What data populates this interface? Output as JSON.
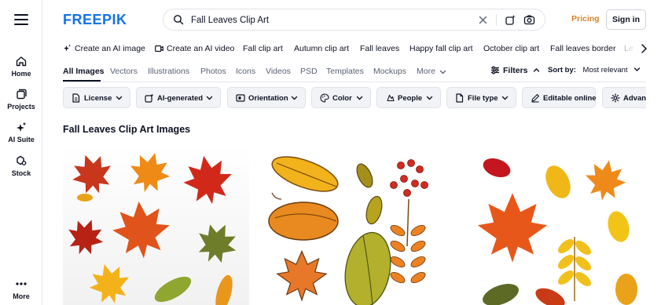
{
  "rail": {
    "home": "Home",
    "projects": "Projects",
    "ai_suite": "AI Suite",
    "stock": "Stock",
    "more": "More"
  },
  "header": {
    "logo": "FREEPIK",
    "search_value": "Fall Leaves Clip Art",
    "pricing": "Pricing",
    "sign_in": "Sign in"
  },
  "quick_links": [
    "Create an AI image",
    "Create an AI video",
    "Fall clip art",
    "Autumn clip art",
    "Fall leaves",
    "Happy fall clip art",
    "October clip art",
    "Fall leaves border",
    "Le"
  ],
  "tabs": [
    "All Images",
    "Vectors",
    "Illustrations",
    "Photos",
    "Icons",
    "Videos",
    "PSD",
    "Templates",
    "Mockups",
    "More"
  ],
  "toolbar": {
    "filters": "Filters",
    "sort_label": "Sort by:",
    "sort_value": "Most relevant"
  },
  "chips": [
    "License",
    "AI-generated",
    "Orientation",
    "Color",
    "People",
    "File type",
    "Editable online",
    "Advanced"
  ],
  "heading": "Fall Leaves Clip Art Images",
  "colors": {
    "brand": "#1273eb",
    "pricing": "#d9822b",
    "text": "#0e1122"
  }
}
